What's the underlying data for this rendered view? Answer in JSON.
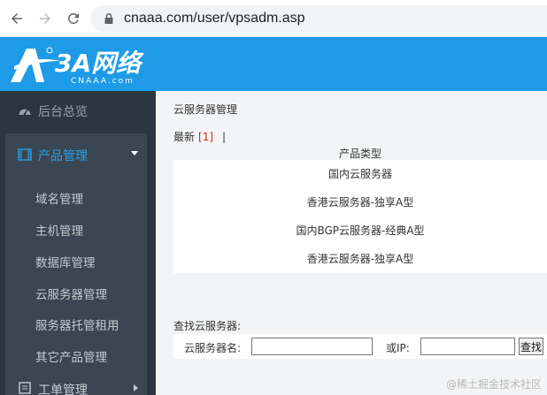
{
  "browser": {
    "url": "cnaaa.com/user/vpsadm.asp"
  },
  "header": {
    "logo_main": "3A网络",
    "logo_sub": "CNAAA.com",
    "brand_color": "#1e9be6"
  },
  "sidebar": {
    "dashboard_label": "后台总览",
    "product_group_label": "产品管理",
    "sub_items": [
      "域名管理",
      "主机管理",
      "数据库管理",
      "云服务器管理",
      "服务器托管租用",
      "其它产品管理"
    ],
    "ticket_label": "工单管理"
  },
  "main": {
    "page_title": "云服务器管理",
    "filter_label": "最新",
    "filter_count": "[1]",
    "filter_separator": "|",
    "column_header": "产品类型",
    "product_types": [
      "国内云服务器",
      "香港云服务器-独享A型",
      "国内BGP云服务器-经典A型",
      "香港云服务器-独享A型"
    ],
    "search_label": "查找云服务器:",
    "search_name_label": "云服务器名:",
    "search_name_value": "",
    "search_ip_label": "或IP:",
    "search_ip_value": "",
    "search_button": "查找"
  },
  "watermark": "@稀土掘金技术社区"
}
